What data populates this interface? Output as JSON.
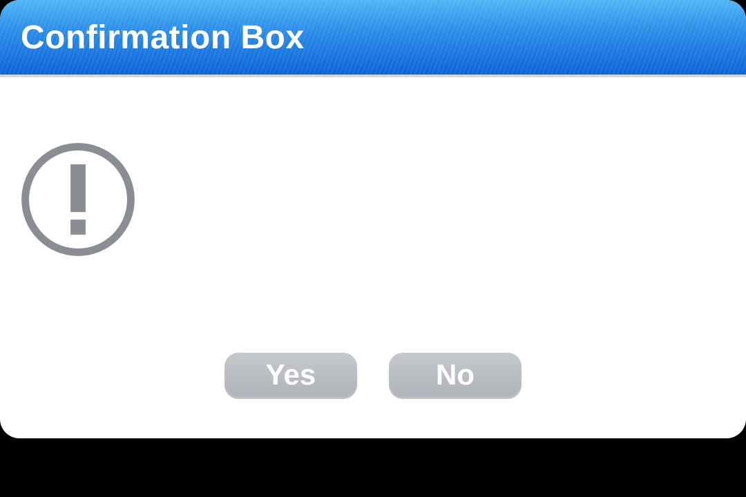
{
  "dialog": {
    "title": "Confirmation Box",
    "icon": "exclamation-circle",
    "buttons": {
      "yes": "Yes",
      "no": "No"
    }
  },
  "colors": {
    "titlebar_top": "#4fb5f7",
    "titlebar_bottom": "#0d63d6",
    "button_bg": "#b7bbc1",
    "icon_stroke": "#8a8e94"
  }
}
